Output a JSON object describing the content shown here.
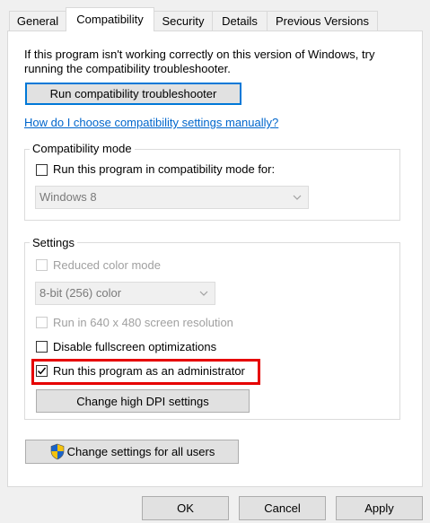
{
  "tabs": [
    {
      "label": "General"
    },
    {
      "label": "Compatibility"
    },
    {
      "label": "Security"
    },
    {
      "label": "Details"
    },
    {
      "label": "Previous Versions"
    }
  ],
  "intro": {
    "line1": "If this program isn't working correctly on this version of Windows, try",
    "line2": "running the compatibility troubleshooter."
  },
  "troubleshooter_button": "Run compatibility troubleshooter",
  "help_link": "How do I choose compatibility settings manually?",
  "compat_mode": {
    "group_label": "Compatibility mode",
    "checkbox_label": "Run this program in compatibility mode for:",
    "checked": false,
    "os_select_value": "Windows 8"
  },
  "settings": {
    "group_label": "Settings",
    "reduced_color_label": "Reduced color mode",
    "color_select_value": "8-bit (256) color",
    "resolution_label": "Run in 640 x 480 screen resolution",
    "fullscreen_label": "Disable fullscreen optimizations",
    "fullscreen_checked": false,
    "admin_label": "Run this program as an administrator",
    "admin_checked": true,
    "dpi_button": "Change high DPI settings"
  },
  "all_users_button": "Change settings for all users",
  "footer": {
    "ok": "OK",
    "cancel": "Cancel",
    "apply": "Apply"
  },
  "colors": {
    "highlight": "#e60000",
    "link": "#0066cc",
    "focus": "#0078d7"
  }
}
